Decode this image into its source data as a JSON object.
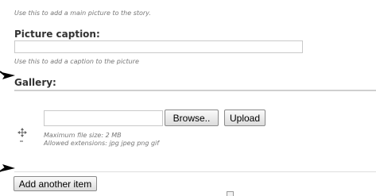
{
  "picture": {
    "hint": "Use this to add a main picture to the story."
  },
  "caption": {
    "label": "Picture caption:",
    "value": "",
    "hint": "Use this to add a caption to the picture"
  },
  "gallery": {
    "label": "Gallery:",
    "file_value": "",
    "browse_label": "Browse..",
    "upload_label": "Upload",
    "max_size": "Maximum file size: 2 MB",
    "extensions": "Allowed extensions: jpg jpeg png gif",
    "drag_handle_icon": "move-arrows-icon",
    "add_item_label": "Add another item"
  },
  "annotations": {
    "arrow_icon": "black-arrow-icon"
  }
}
